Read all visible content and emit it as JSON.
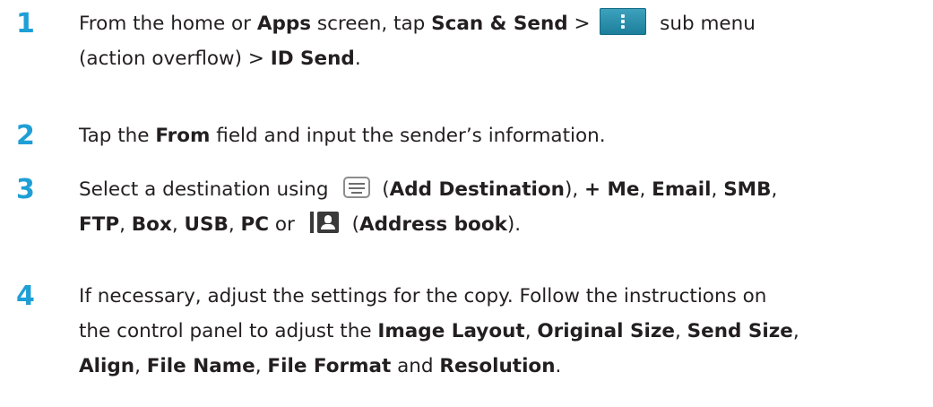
{
  "steps": [
    {
      "number": "1",
      "line1": {
        "t1": "From the home or ",
        "b1": "Apps",
        "t2": " screen, tap ",
        "b2": "Scan & Send",
        "t3": " > ",
        "t4": " sub menu"
      },
      "line2": {
        "t1": "(action overflow) > ",
        "b1": "ID Send",
        "t2": "."
      }
    },
    {
      "number": "2",
      "line1": {
        "t1": "Tap the ",
        "b1": "From",
        "t2": " field and input the sender’s information."
      }
    },
    {
      "number": "3",
      "line1": {
        "t1": "Select a destination using ",
        "t2": " (",
        "b1": "Add Destination",
        "t3": "), ",
        "b2": "+ Me",
        "t4": ", ",
        "b3": "Email",
        "t5": ", ",
        "b4": "SMB",
        "t6": ","
      },
      "line2": {
        "b1": "FTP",
        "t1": ", ",
        "b2": "Box",
        "t2": ", ",
        "b3": "USB",
        "t3": ", ",
        "b4": "PC",
        "t4": " or ",
        "t5": " (",
        "b5": "Address book",
        "t6": ")."
      }
    },
    {
      "number": "4",
      "line1": {
        "t1": "If necessary, adjust the settings for the copy. Follow the instructions on"
      },
      "line2": {
        "t1": "the control panel to adjust the ",
        "b1": "Image Layout",
        "t2": ", ",
        "b2": "Original Size",
        "t3": ", ",
        "b3": "Send Size",
        "t4": ","
      },
      "line3": {
        "b1": "Align",
        "t1": ", ",
        "b2": "File Name",
        "t2": ", ",
        "b3": "File Format",
        "t3": " and ",
        "b4": "Resolution",
        "t4": "."
      }
    }
  ],
  "icons": {
    "menu": "action-overflow-menu-icon",
    "keyboard": "keyboard-icon",
    "address_book": "address-book-icon"
  },
  "colors": {
    "step_number": "#1f9fd6",
    "text": "#231f20",
    "menu_icon_bg": "#2a8fac"
  }
}
